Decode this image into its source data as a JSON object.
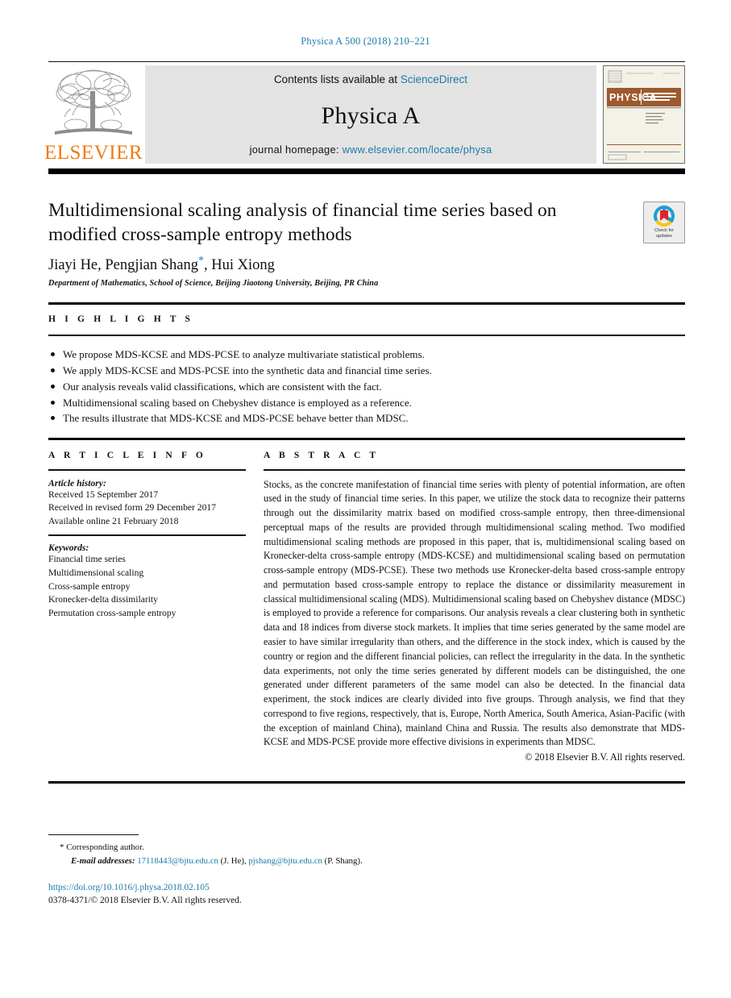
{
  "running_head": "Physica A 500 (2018) 210–221",
  "journal_header": {
    "contents_prefix": "Contents lists available at ",
    "sciencedirect": "ScienceDirect",
    "journal_title": "Physica A",
    "homepage_prefix": "journal homepage: ",
    "homepage_url": "www.elsevier.com/locate/physa",
    "publisher_logo_text": "ELSEVIER",
    "cover_banner_text": "PHYSICA",
    "cover_subtitle": "STATISTICAL MECHANICS AND ITS APPLICATIONS"
  },
  "colors": {
    "link": "#1a7ba8",
    "elsevier_orange": "#ee7b11",
    "header_band": "#e3e3e3",
    "cover_brown": "#9c5a2d"
  },
  "article": {
    "title": "Multidimensional scaling analysis of financial time series based on modified cross-sample entropy methods",
    "authors": "Jiayi He, Pengjian Shang",
    "authors_tail": ", Hui Xiong",
    "corresponding_marker": "*",
    "affiliation": "Department of Mathematics, School of Science, Beijing Jiaotong University, Beijing, PR China",
    "crossmark_label_line1": "Check for",
    "crossmark_label_line2": "updates"
  },
  "highlights": {
    "heading": "H I G H L I G H T S",
    "items": [
      "We propose MDS-KCSE and MDS-PCSE to analyze multivariate statistical problems.",
      "We apply MDS-KCSE and MDS-PCSE into the synthetic data and financial time series.",
      "Our analysis reveals valid classifications, which are consistent with the fact.",
      "Multidimensional scaling based on Chebyshev distance is employed as a reference.",
      "The results illustrate that MDS-KCSE and MDS-PCSE behave better than MDSC."
    ]
  },
  "article_info": {
    "heading": "A R T I C L E   I N F O",
    "history_label": "Article history:",
    "history": [
      "Received 15 September 2017",
      "Received in revised form 29 December 2017",
      "Available online 21 February 2018"
    ],
    "keywords_label": "Keywords:",
    "keywords": [
      "Financial time series",
      "Multidimensional scaling",
      "Cross-sample entropy",
      "Kronecker-delta dissimilarity",
      "Permutation cross-sample entropy"
    ]
  },
  "abstract": {
    "heading": "A B S T R A C T",
    "body": "Stocks, as the concrete manifestation of financial time series with plenty of potential information, are often used in the study of financial time series. In this paper, we utilize the stock data to recognize their patterns through out the dissimilarity matrix based on modified cross-sample entropy, then three-dimensional perceptual maps of the results are provided through multidimensional scaling method. Two modified multidimensional scaling methods are proposed in this paper, that is, multidimensional scaling based on Kronecker-delta cross-sample entropy (MDS-KCSE) and multidimensional scaling based on permutation cross-sample entropy (MDS-PCSE). These two methods use Kronecker-delta based cross-sample entropy and permutation based cross-sample entropy to replace the distance or dissimilarity measurement in classical multidimensional scaling (MDS). Multidimensional scaling based on Chebyshev distance (MDSC) is employed to provide a reference for comparisons. Our analysis reveals a clear clustering both in synthetic data and 18 indices from diverse stock markets. It implies that time series generated by the same model are easier to have similar irregularity than others, and the difference in the stock index, which is caused by the country or region and the different financial policies, can reflect the irregularity in the data. In the synthetic data experiments, not only the time series generated by different models can be distinguished, the one generated under different parameters of the same model can also be detected. In the financial data experiment, the stock indices are clearly divided into five groups. Through analysis, we find that they correspond to five regions, respectively, that is, Europe, North America, South America, Asian-Pacific (with the exception of mainland China), mainland China and Russia. The results also demonstrate that MDS-KCSE and MDS-PCSE provide more effective divisions in experiments than MDSC.",
    "copyright": "© 2018 Elsevier B.V. All rights reserved."
  },
  "footnote": {
    "corresponding_star": "*",
    "corresponding_text": "Corresponding author.",
    "email_label": "E-mail addresses:",
    "email1": "17118443@bjtu.edu.cn",
    "email1_owner": "(J. He),",
    "email2": "pjshang@bjtu.edu.cn",
    "email2_owner": "(P. Shang).",
    "doi": "https://doi.org/10.1016/j.physa.2018.02.105",
    "issn_line": "0378-4371/© 2018 Elsevier B.V. All rights reserved."
  }
}
